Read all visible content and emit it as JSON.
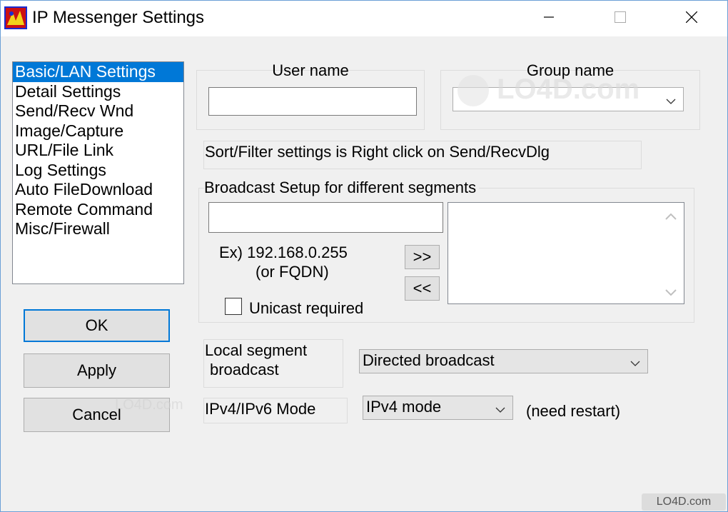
{
  "window": {
    "title": "IP Messenger Settings",
    "accent": "#0078d7"
  },
  "categories": {
    "items": [
      {
        "label": "Basic/LAN Settings",
        "selected": true
      },
      {
        "label": "Detail Settings"
      },
      {
        "label": "Send/Recv Wnd"
      },
      {
        "label": "Image/Capture"
      },
      {
        "label": "URL/File Link"
      },
      {
        "label": "Log Settings"
      },
      {
        "label": "Auto FileDownload"
      },
      {
        "label": "Remote Command"
      },
      {
        "label": "Misc/Firewall"
      }
    ]
  },
  "buttons": {
    "ok": "OK",
    "apply": "Apply",
    "cancel": "Cancel",
    "add": ">>",
    "remove": "<<"
  },
  "user": {
    "label": "User name",
    "value": ""
  },
  "group": {
    "label": "Group name",
    "value": ""
  },
  "hint": {
    "sort_filter": "Sort/Filter settings is Right click on Send/RecvDlg"
  },
  "broadcast": {
    "label": "Broadcast Setup for different segments",
    "input_value": "",
    "example_line1": "Ex) 192.168.0.255",
    "example_line2": "(or FQDN)",
    "unicast_label": "Unicast required",
    "unicast_checked": false,
    "list_items": []
  },
  "local_segment": {
    "label_line1": "Local segment",
    "label_line2": "broadcast",
    "value": "Directed broadcast"
  },
  "ip_mode": {
    "label": "IPv4/IPv6 Mode",
    "value": "IPv4 mode",
    "note": "(need restart)"
  },
  "watermarks": {
    "main": "LO4D.com",
    "small": "LO4D.com",
    "corner": "LO4D.com"
  }
}
